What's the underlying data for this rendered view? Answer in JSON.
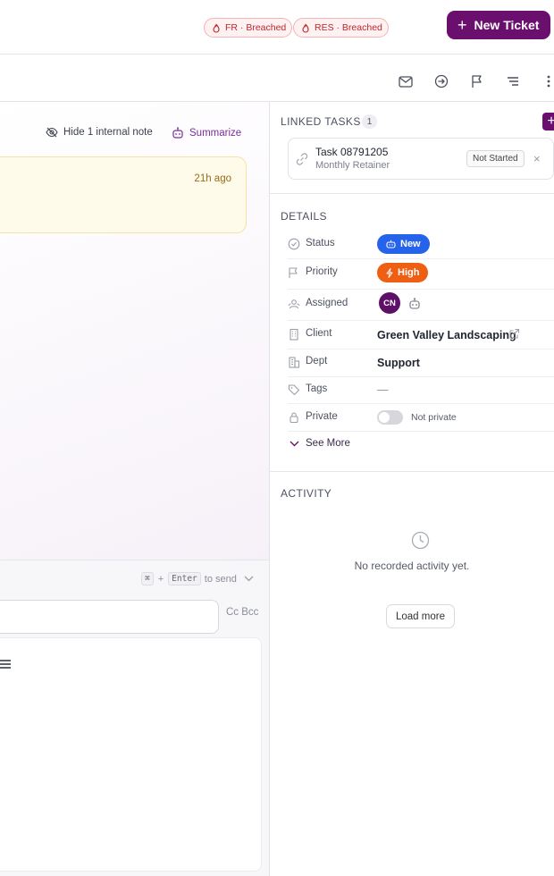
{
  "header": {
    "new_ticket_label": "New Ticket"
  },
  "sla_badges": [
    {
      "label": "FR · Breached"
    },
    {
      "label": "RES · Breached"
    }
  ],
  "conversation": {
    "hide_note_label": "Hide 1 internal note",
    "summarize_label": "Summarize",
    "note_time": "21h ago"
  },
  "composer": {
    "shortcut_symbol": "⌘",
    "shortcut_plus": "+",
    "shortcut_key": "Enter",
    "shortcut_suffix": "to send",
    "cc_bcc_label": "Cc Bcc"
  },
  "linked_tasks": {
    "title": "LINKED TASKS",
    "count": "1",
    "add_label": "+",
    "task": {
      "title": "Task 08791205",
      "subtitle": "Monthly Retainer",
      "status": "Not Started",
      "remove_label": "×"
    }
  },
  "details": {
    "title": "DETAILS",
    "status": {
      "label": "Status",
      "value": "New",
      "color": "#2563eb"
    },
    "priority": {
      "label": "Priority",
      "value": "High",
      "color": "#ef5f13"
    },
    "assigned": {
      "label": "Assigned",
      "initials": "CN"
    },
    "client": {
      "label": "Client",
      "value": "Green Valley Landscaping"
    },
    "dept": {
      "label": "Dept",
      "value": "Support"
    },
    "tags": {
      "label": "Tags",
      "value": "—"
    },
    "private": {
      "label": "Private",
      "value": "Not private",
      "enabled": false
    },
    "see_more_label": "See More"
  },
  "activity": {
    "title": "ACTIVITY",
    "empty_text": "No recorded activity yet.",
    "load_more_label": "Load more"
  },
  "colors": {
    "brand": "#6a0f6e",
    "breach": "#c0262d"
  }
}
